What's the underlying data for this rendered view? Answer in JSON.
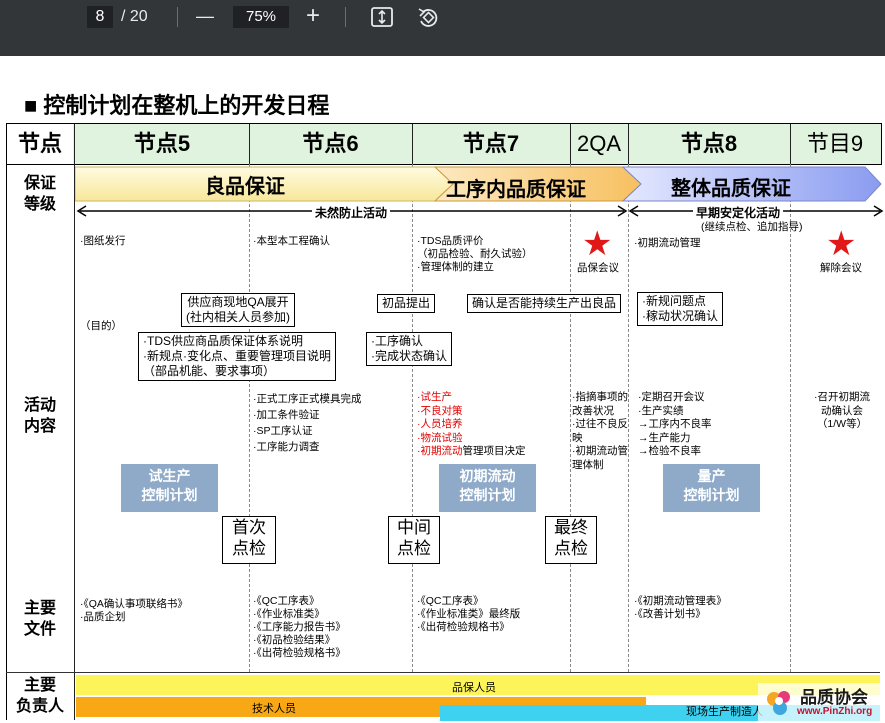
{
  "toolbar": {
    "page_current": "8",
    "page_total": "/ 20",
    "zoom_out": "—",
    "zoom": "75%",
    "zoom_in": "+",
    "fit_icon": "fit-page-icon",
    "rotate_icon": "rotate-icon"
  },
  "doc": {
    "title": "■ 控制计划在整机上的开发日程",
    "header": {
      "label": "节点",
      "nodes": [
        "节点5",
        "节点6",
        "节点7",
        "2QA",
        "节点8",
        "节目9"
      ]
    },
    "rows": {
      "assurance": "保证\n等级",
      "activity": "活动\n内容",
      "docs": "主要\n文件",
      "owner": "主要\n负责人"
    },
    "assurance": {
      "good": "良品保证",
      "process": "工序内品质保证",
      "overall": "整体品质保证",
      "prevent": "未然防止活动",
      "early": "早期安定化活动",
      "early_sub": "(继续点检、追加指导)"
    },
    "activities": {
      "c1_top": "·图纸发行",
      "c1_purpose": "（目的）",
      "c2_top": "·本型本工程确认",
      "c3_top": [
        "·TDS品质评价",
        "（初品检验、耐久试验）",
        "·管理体制的建立"
      ],
      "qa_meeting": "品保会议",
      "c5_top": "·初期流动管理",
      "release_meeting": "解除会议",
      "supplier_box": [
        "供应商现地QA展开",
        "(社内相关人员参加)"
      ],
      "tds_box": [
        "·TDS供应商品质保证体系说明",
        "·新规点·变化点、重要管理项目说明",
        "（部品机能、要求事项）"
      ],
      "first_submit": "初品提出",
      "confirm_box": "确认是否能持续生产出良品",
      "process_box": [
        "·工序确认",
        "·完成状态确认"
      ],
      "new_issue_box": [
        "·新规问题点",
        "·稼动状况确认"
      ],
      "c2_mid": [
        "·正式工序正式模具完成",
        "·加工条件验证",
        "·SP工序认证",
        "·工序能力调查"
      ],
      "c3_mid_red": [
        "·试生产",
        "·不良对策",
        "·人员培养",
        "·物流试验"
      ],
      "c3_mid_last_red": "·初期流动",
      "c3_mid_last": "管理项目决定",
      "c4_mid": [
        "·指摘事项的",
        "改善状况",
        "·过往不良反",
        "映",
        "·初期流动管",
        "理体制"
      ],
      "c5_mid": [
        "·定期召开会议",
        "·生产实绩",
        "→工序内不良率",
        "→生产能力",
        "→检验不良率"
      ],
      "c6_mid": [
        "·召开初期流",
        "动确认会",
        "（1/W等）"
      ]
    },
    "plans": {
      "trial": "试生产\n控制计划",
      "initial": "初期流动\n控制计划",
      "mass": "量产\n控制计划"
    },
    "checks": {
      "first": "首次\n点检",
      "middle": "中间\n点检",
      "final": "最终\n点检"
    },
    "documents": {
      "c1": [
        "·《QA确认事项联络书》",
        "·品质企划"
      ],
      "c2": [
        "·《QC工序表》",
        "·《作业标准类》",
        "·《工序能力报告书》",
        "·《初品检验结果》",
        "·《出荷检验规格书》"
      ],
      "c3": [
        "·《QC工序表》",
        "·《作业标准类》最终版",
        "·《出荷检验规格书》"
      ],
      "c5": [
        "·《初期流动管理表》",
        "·《改善计划书》"
      ]
    },
    "owners": {
      "qa": "品保人员",
      "tech": "技术人员",
      "field": "现场生产制造人"
    },
    "watermark": {
      "name": "品质协会",
      "url": "www.PinZhi.org"
    }
  }
}
